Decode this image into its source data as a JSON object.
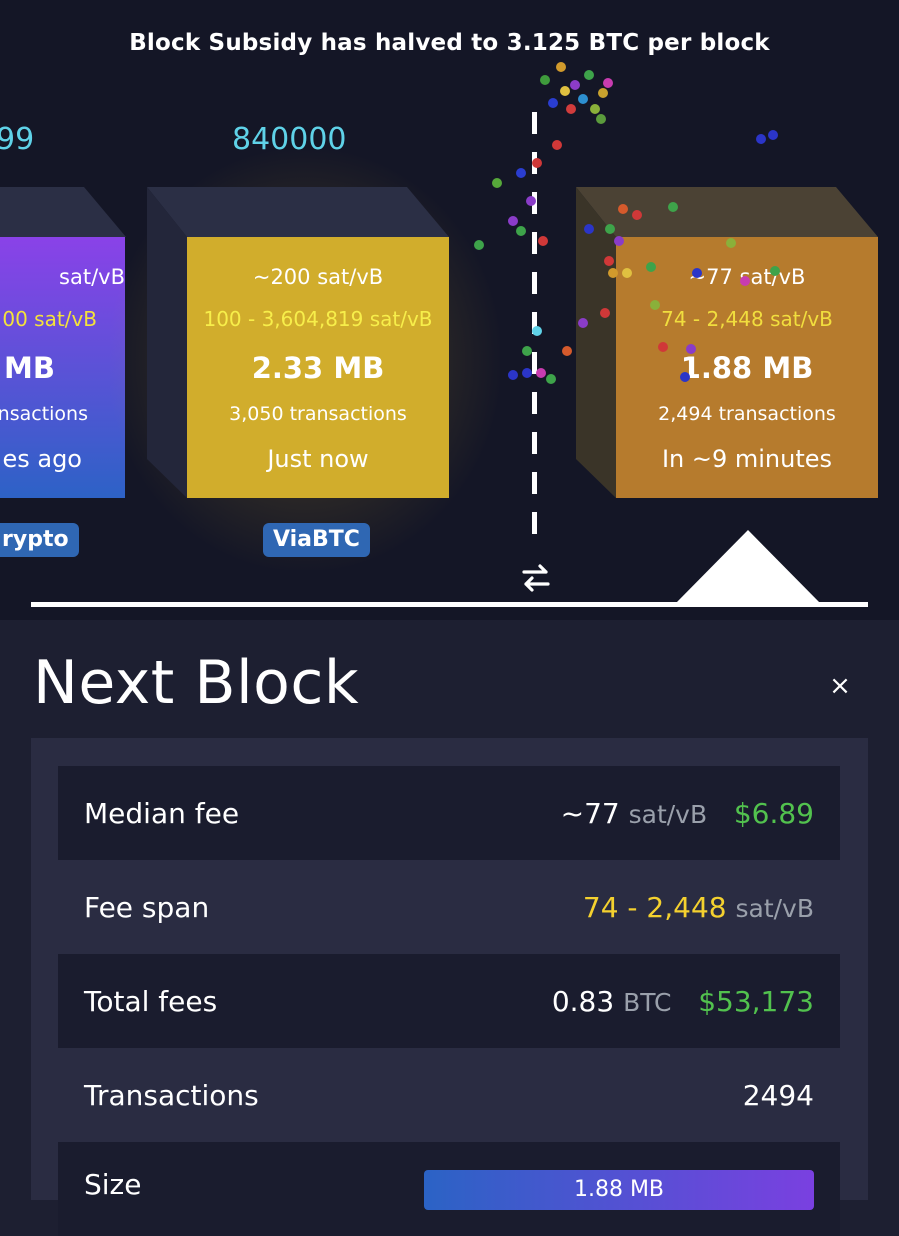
{
  "banner": "Block Subsidy has halved to 3.125 BTC per block",
  "blocks": {
    "prev": {
      "height": "99",
      "median_fee": "sat/vB",
      "fee_range": "00 sat/vB",
      "size": "MB",
      "tx_count": "nsactions",
      "time": "es ago",
      "pool": "rypto"
    },
    "current": {
      "height": "840000",
      "median_fee": "~200 sat/vB",
      "fee_range": "100 - 3,604,819 sat/vB",
      "size": "2.33 MB",
      "tx_count": "3,050 transactions",
      "time": "Just now",
      "pool": "ViaBTC"
    },
    "next": {
      "median_fee": "~77 sat/vB",
      "fee_range": "74 - 2,448 sat/vB",
      "size": "1.88 MB",
      "tx_count": "2,494 transactions",
      "time": "In ~9 minutes"
    }
  },
  "icons": {
    "swap": "swap-arrows-icon",
    "close": "close-icon"
  },
  "panel": {
    "title": "Next Block",
    "close": "×",
    "rows": {
      "median_fee": {
        "label": "Median fee",
        "value": "~77",
        "unit": "sat/vB",
        "usd": "$6.89"
      },
      "fee_span": {
        "label": "Fee span",
        "value": "74 - 2,448",
        "unit": "sat/vB"
      },
      "total_fees": {
        "label": "Total fees",
        "value": "0.83",
        "unit": "BTC",
        "usd": "$53,173"
      },
      "transactions": {
        "label": "Transactions",
        "value": "2494"
      },
      "size": {
        "label": "Size",
        "value": "1.88 MB"
      }
    }
  },
  "colors": {
    "background": "#141626",
    "panel_bg": "#1d1f31",
    "accent_cyan": "#5fd2e8",
    "fee_yellow": "#f4d12f",
    "usd_green": "#52c24e",
    "pool_badge": "#2f67b3"
  }
}
